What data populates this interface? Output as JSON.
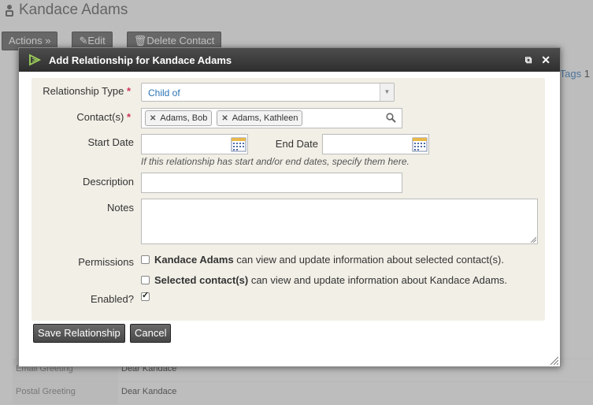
{
  "page": {
    "title": "Kandace Adams",
    "actions": [
      "Actions »",
      "Edit",
      "Delete Contact"
    ],
    "tags_label": "Tags",
    "tags_count": "1",
    "rows": [
      {
        "label": "Email Greeting",
        "value": "Dear Kandace"
      },
      {
        "label": "Postal Greeting",
        "value": "Dear Kandace"
      }
    ]
  },
  "dialog": {
    "title": "Add Relationship for Kandace Adams",
    "relationship_type_label": "Relationship Type",
    "relationship_type_value": "Child of",
    "contacts_label": "Contact(s)",
    "contacts": [
      "Adams, Bob",
      "Adams, Kathleen"
    ],
    "start_date_label": "Start Date",
    "end_date_label": "End Date",
    "date_help": "If this relationship has start and/or end dates, specify them here.",
    "description_label": "Description",
    "notes_label": "Notes",
    "permissions_label": "Permissions",
    "perm1_bold": "Kandace Adams",
    "perm1_rest": " can view and update information about selected contact(s).",
    "perm1_checked": false,
    "perm2_bold": "Selected contact(s)",
    "perm2_rest": " can view and update information about Kandace Adams.",
    "perm2_checked": false,
    "enabled_label": "Enabled?",
    "enabled_checked": true,
    "save_label": "Save Relationship",
    "cancel_label": "Cancel",
    "required_marker": "*"
  },
  "colors": {
    "link": "#2b73b5",
    "required": "#cf3458",
    "titlebar": "#3a3a3a",
    "form_bg": "#f1efe6"
  }
}
